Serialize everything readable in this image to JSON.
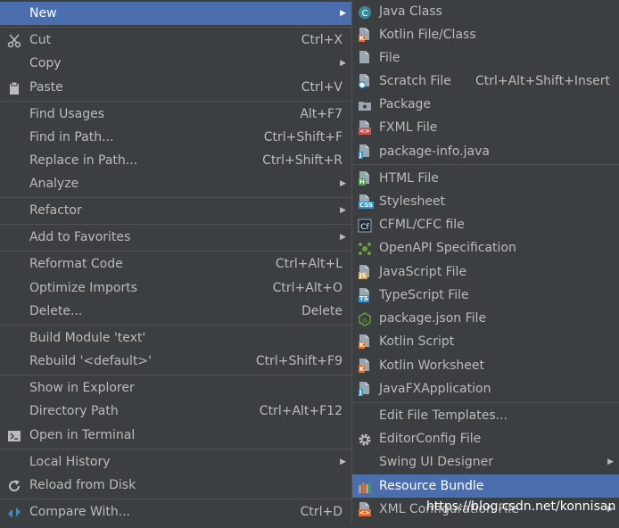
{
  "left_menu": {
    "items": [
      {
        "label": "New",
        "shortcut": "",
        "submenu": true,
        "selected": true
      },
      {
        "label": "Cut",
        "shortcut": "Ctrl+X",
        "icon": "scissors-icon"
      },
      {
        "label": "Copy",
        "shortcut": "",
        "submenu": true
      },
      {
        "label": "Paste",
        "shortcut": "Ctrl+V",
        "icon": "clipboard-icon"
      },
      {
        "label": "Find Usages",
        "shortcut": "Alt+F7"
      },
      {
        "label": "Find in Path...",
        "shortcut": "Ctrl+Shift+F"
      },
      {
        "label": "Replace in Path...",
        "shortcut": "Ctrl+Shift+R"
      },
      {
        "label": "Analyze",
        "shortcut": "",
        "submenu": true
      },
      {
        "label": "Refactor",
        "shortcut": "",
        "submenu": true
      },
      {
        "label": "Add to Favorites",
        "shortcut": "",
        "submenu": true
      },
      {
        "label": "Reformat Code",
        "shortcut": "Ctrl+Alt+L"
      },
      {
        "label": "Optimize Imports",
        "shortcut": "Ctrl+Alt+O"
      },
      {
        "label": "Delete...",
        "shortcut": "Delete"
      },
      {
        "label": "Build Module 'text'",
        "shortcut": ""
      },
      {
        "label": "Rebuild '<default>'",
        "shortcut": "Ctrl+Shift+F9"
      },
      {
        "label": "Show in Explorer",
        "shortcut": ""
      },
      {
        "label": "Directory Path",
        "shortcut": "Ctrl+Alt+F12"
      },
      {
        "label": "Open in Terminal",
        "shortcut": "",
        "icon": "terminal-icon"
      },
      {
        "label": "Local History",
        "shortcut": "",
        "submenu": true
      },
      {
        "label": "Reload from Disk",
        "shortcut": "",
        "icon": "reload-icon"
      },
      {
        "label": "Compare With...",
        "shortcut": "Ctrl+D",
        "icon": "compare-icon"
      }
    ]
  },
  "right_menu": {
    "items": [
      {
        "label": "Java Class",
        "shortcut": "",
        "icon": "java-class-icon"
      },
      {
        "label": "Kotlin File/Class",
        "shortcut": "",
        "icon": "kotlin-file-icon"
      },
      {
        "label": "File",
        "shortcut": "",
        "icon": "file-icon"
      },
      {
        "label": "Scratch File",
        "shortcut": "Ctrl+Alt+Shift+Insert",
        "icon": "scratch-file-icon"
      },
      {
        "label": "Package",
        "shortcut": "",
        "icon": "package-icon"
      },
      {
        "label": "FXML File",
        "shortcut": "",
        "icon": "fxml-file-icon"
      },
      {
        "label": "package-info.java",
        "shortcut": "",
        "icon": "package-info-icon"
      },
      {
        "label": "HTML File",
        "shortcut": "",
        "icon": "html-file-icon"
      },
      {
        "label": "Stylesheet",
        "shortcut": "",
        "icon": "stylesheet-icon"
      },
      {
        "label": "CFML/CFC file",
        "shortcut": "",
        "icon": "cfml-file-icon"
      },
      {
        "label": "OpenAPI Specification",
        "shortcut": "",
        "icon": "openapi-icon"
      },
      {
        "label": "JavaScript File",
        "shortcut": "",
        "icon": "javascript-file-icon"
      },
      {
        "label": "TypeScript File",
        "shortcut": "",
        "icon": "typescript-file-icon"
      },
      {
        "label": "package.json File",
        "shortcut": "",
        "icon": "package-json-icon"
      },
      {
        "label": "Kotlin Script",
        "shortcut": "",
        "icon": "kotlin-script-icon"
      },
      {
        "label": "Kotlin Worksheet",
        "shortcut": "",
        "icon": "kotlin-worksheet-icon"
      },
      {
        "label": "JavaFXApplication",
        "shortcut": "",
        "icon": "javafx-icon"
      },
      {
        "label": "Edit File Templates...",
        "shortcut": ""
      },
      {
        "label": "EditorConfig File",
        "shortcut": "",
        "icon": "gear-icon"
      },
      {
        "label": "Swing UI Designer",
        "shortcut": "",
        "submenu": true
      },
      {
        "label": "Resource Bundle",
        "shortcut": "",
        "icon": "resource-bundle-icon",
        "selected": true
      },
      {
        "label": "XML Configuration File",
        "shortcut": "",
        "submenu": true,
        "icon": "xml-file-icon"
      }
    ]
  },
  "watermark": "https://blog.csdn.net/konnisan",
  "colors": {
    "background": "#3c3f41",
    "selection": "#4b6eaf",
    "text": "#bbbbbb",
    "separator": "#515151"
  }
}
